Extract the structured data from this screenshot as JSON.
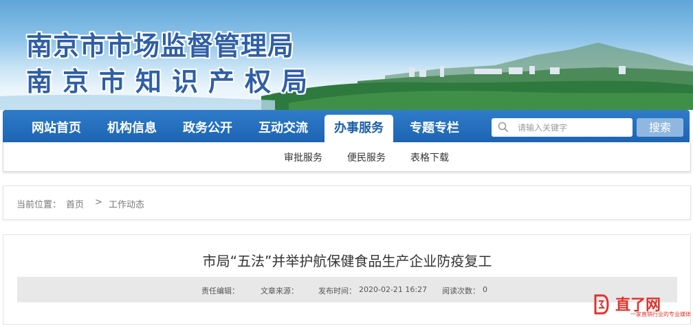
{
  "header": {
    "title_line1": "南京市市场监督管理局",
    "title_line2": "南京市知识产权局"
  },
  "nav": {
    "items": [
      "网站首页",
      "机构信息",
      "政务公开",
      "互动交流",
      "办事服务",
      "专题专栏"
    ],
    "active": "办事服务"
  },
  "search": {
    "placeholder": "请输入关键字",
    "button": "搜索"
  },
  "subnav": {
    "items": [
      "审批服务",
      "便民服务",
      "表格下载"
    ]
  },
  "breadcrumb": {
    "prefix": "当前位置：",
    "home": "首页",
    "separator": ">",
    "current": "工作动态"
  },
  "article": {
    "title": "市局“五法”并举护航保健食品生产企业防疫复工",
    "meta": {
      "editor_label": "责任编辑：",
      "source_label": "文章来源：",
      "publish_label": "发布时间：",
      "publish_time": "2020-02-21 16:27",
      "views_label": "阅读次数：",
      "views": "0"
    }
  },
  "watermark": {
    "brand": "直了网",
    "tagline": "一家直销行业的专业媒体"
  },
  "colors": {
    "nav_blue": "#1d64b3",
    "title_blue": "#2f5fa6",
    "watermark_red": "#e0322c"
  }
}
